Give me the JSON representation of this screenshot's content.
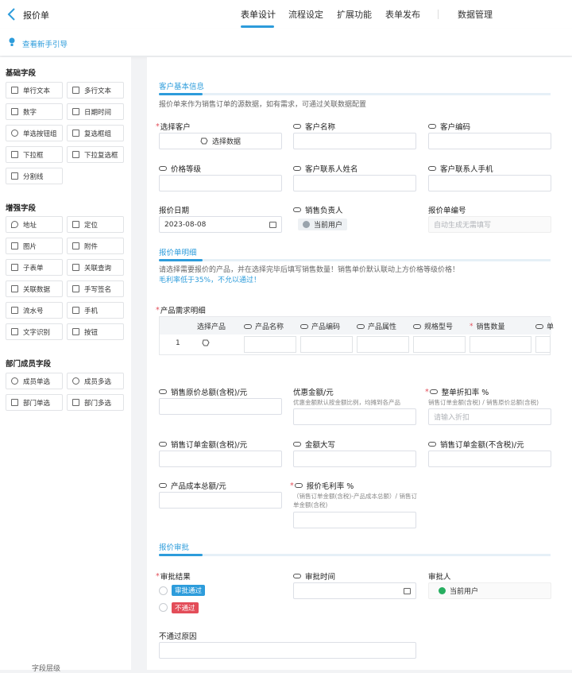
{
  "header": {
    "title": "报价单",
    "tabs": [
      "表单设计",
      "流程设定",
      "扩展功能",
      "表单发布",
      "数据管理"
    ],
    "guide": "查看新手引导"
  },
  "sidebar": {
    "basic_title": "基础字段",
    "basic": [
      "单行文本",
      "多行文本",
      "数字",
      "日期时间",
      "单选按钮组",
      "复选框组",
      "下拉框",
      "下拉复选框",
      "分割线"
    ],
    "enhanced_title": "增强字段",
    "enhanced": [
      "地址",
      "定位",
      "图片",
      "附件",
      "子表单",
      "关联查询",
      "关联数据",
      "手写签名",
      "流水号",
      "手机",
      "文字识别",
      "按钮"
    ],
    "dept_title": "部门成员字段",
    "dept": [
      "成员单选",
      "成员多选",
      "部门单选",
      "部门多选"
    ],
    "bottom": "字段层级"
  },
  "form": {
    "sec1": {
      "title": "客户基本信息",
      "desc": "报价单来作为销售订单的源数据，如有需求，可通过关联数据配置",
      "select_customer": "选择客户",
      "select_data": "选择数据",
      "customer_name": "客户名称",
      "customer_code": "客户编码",
      "price_level": "价格等级",
      "contact_name": "客户联系人姓名",
      "contact_phone": "客户联系人手机",
      "quote_date": "报价日期",
      "quote_date_value": "2023-08-08",
      "sales_owner": "销售负责人",
      "current_user": "当前用户",
      "quote_no": "报价单编号",
      "quote_no_ph": "自动生成无需填写"
    },
    "sec2": {
      "title": "报价单明细",
      "desc1": "请选择需要报价的产品，并在选择完毕后填写销售数量！销售单价默认联动上方价格等级价格！",
      "desc2": "毛利率低于35%，不允以通过！",
      "table_label": "产品需求明细",
      "row_no": "1",
      "cols": [
        "选择产品",
        "产品名称",
        "产品编码",
        "产品属性",
        "规格型号",
        "销售数量",
        "单"
      ],
      "original_total": "销售原价总额(含税)/元",
      "discount_amount": "优惠金额/元",
      "discount_note": "优惠金额默认按金额比例，均摊到各产品",
      "discount_rate": "整单折扣率 %",
      "discount_rate_note": "销售订单金额(含税) / 销售原价总额(含税)",
      "discount_rate_ph": "请输入折扣",
      "order_amount_tax": "销售订单金额(含税)/元",
      "amount_upper": "金额大写",
      "order_amount_notax": "销售订单金额(不含税)/元",
      "cost_total": "产品成本总额/元",
      "gross_margin": "报价毛利率 %",
      "gross_margin_note": "（销售订单金额(含税)-产品成本总额）/ 销售订单金额(含税)"
    },
    "sec3": {
      "title": "报价审批",
      "result": "审批结果",
      "pass": "审批通过",
      "fail": "不通过",
      "time": "审批时间",
      "approver": "审批人",
      "current_user": "当前用户",
      "reason": "不通过原因"
    }
  },
  "colors": {
    "accent": "#2d9cdb",
    "pass": "#2d9cdb",
    "fail": "#e34d59"
  }
}
